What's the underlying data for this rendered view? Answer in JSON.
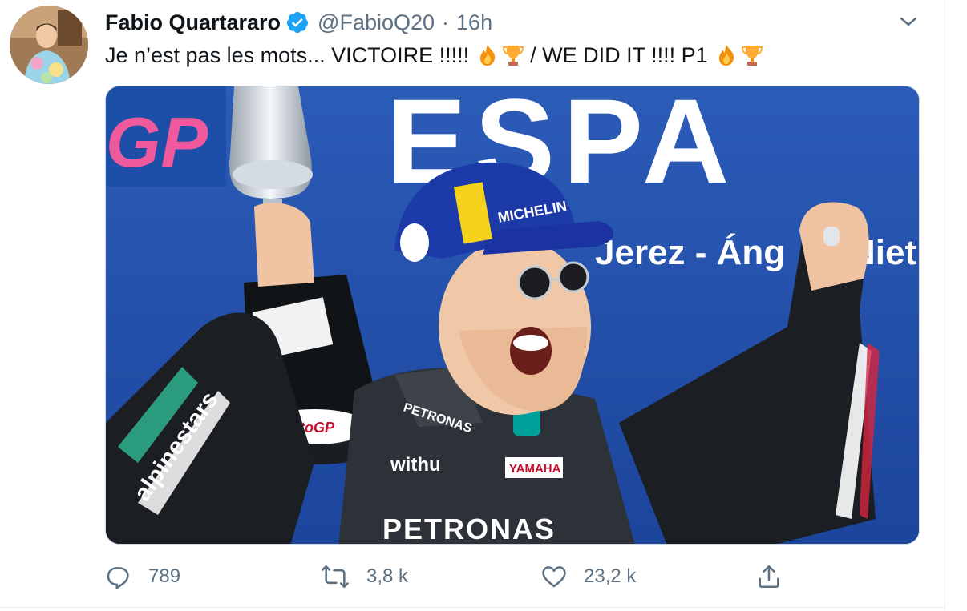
{
  "tweet": {
    "author": {
      "display_name": "Fabio Quartararo",
      "handle": "@FabioQ20",
      "verified": true,
      "avatar_icon": "profile-photo"
    },
    "separator": "·",
    "time": "16h",
    "text_part1": "Je n’est pas les mots... VICTOIRE !!!!!",
    "text_part2": "/ WE DID IT !!!! P1",
    "emojis": [
      "fire",
      "trophy"
    ],
    "media": {
      "type": "photo",
      "visible_text": [
        "GP",
        "ESPA",
        "Jerez - Áng",
        "Niet",
        "MICHELIN",
        "PETRONAS",
        "withu",
        "YAMAHA",
        "alpinestars",
        "motoGP"
      ]
    },
    "actions": {
      "reply_count": "789",
      "retweet_count": "3,8 k",
      "like_count": "23,2 k",
      "reply_icon": "reply-icon",
      "retweet_icon": "retweet-icon",
      "like_icon": "heart-icon",
      "share_icon": "share-icon"
    }
  },
  "colors": {
    "verified": "#1da1f2",
    "secondary_text": "#5b7083",
    "primary_text": "#0f1419",
    "border": "#e6ecf0"
  }
}
